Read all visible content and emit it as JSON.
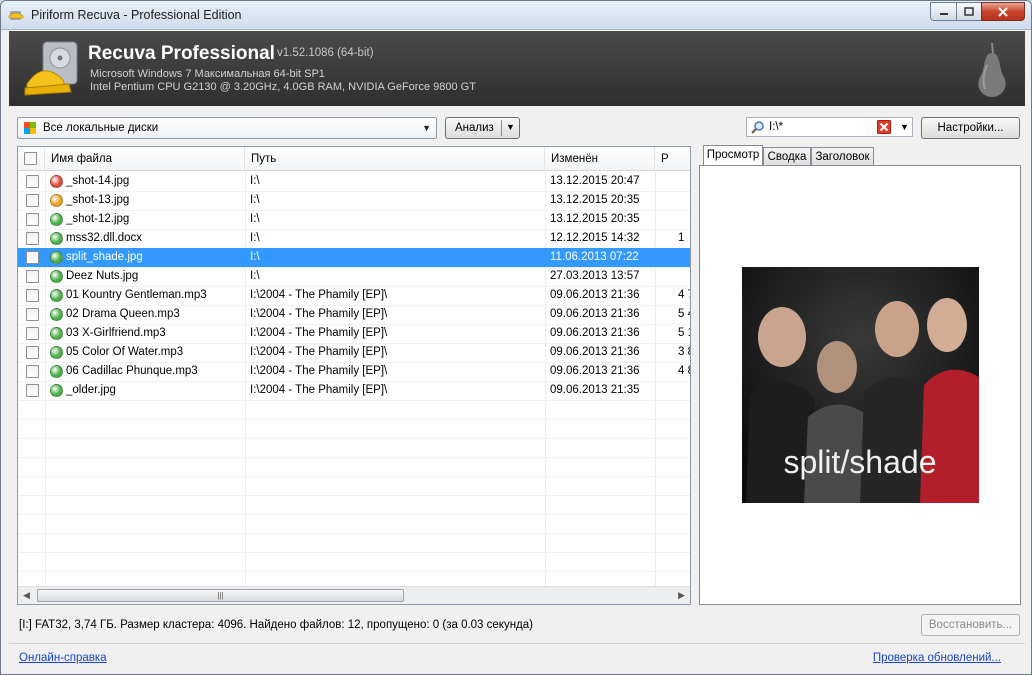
{
  "window": {
    "title": "Piriform Recuva - Professional Edition"
  },
  "header": {
    "product": "Recuva Professional",
    "version": "v1.52.1086 (64-bit)",
    "os": "Microsoft Windows 7 Максимальная 64-bit SP1",
    "cpu": "Intel Pentium CPU G2130 @ 3.20GHz, 4.0GB RAM, NVIDIA GeForce 9800 GT"
  },
  "toolbar": {
    "drive_value": "Все локальные диски",
    "scan_label": "Анализ",
    "search_value": "I:\\*",
    "options_label": "Настройки..."
  },
  "columns": {
    "name": "Имя файла",
    "path": "Путь",
    "modified": "Изменён",
    "size": "Р"
  },
  "files": [
    {
      "name": "_shot-14.jpg",
      "path": "I:\\",
      "modified": "13.12.2015 20:47",
      "size": "",
      "state": "red",
      "selected": false
    },
    {
      "name": "_shot-13.jpg",
      "path": "I:\\",
      "modified": "13.12.2015 20:35",
      "size": "",
      "state": "orange",
      "selected": false
    },
    {
      "name": "_shot-12.jpg",
      "path": "I:\\",
      "modified": "13.12.2015 20:35",
      "size": "",
      "state": "green",
      "selected": false
    },
    {
      "name": "mss32.dll.docx",
      "path": "I:\\",
      "modified": "12.12.2015 14:32",
      "size": "1",
      "state": "green",
      "selected": false
    },
    {
      "name": "split_shade.jpg",
      "path": "I:\\",
      "modified": "11.06.2013 07:22",
      "size": "",
      "state": "green",
      "selected": true
    },
    {
      "name": "Deez Nuts.jpg",
      "path": "I:\\",
      "modified": "27.03.2013 13:57",
      "size": "",
      "state": "green",
      "selected": false
    },
    {
      "name": "01 Kountry Gentleman.mp3",
      "path": "I:\\2004 - The Phamily [EP]\\",
      "modified": "09.06.2013 21:36",
      "size": "4 7",
      "state": "green",
      "selected": false
    },
    {
      "name": "02 Drama Queen.mp3",
      "path": "I:\\2004 - The Phamily [EP]\\",
      "modified": "09.06.2013 21:36",
      "size": "5 4",
      "state": "green",
      "selected": false
    },
    {
      "name": "03 X-Girlfriend.mp3",
      "path": "I:\\2004 - The Phamily [EP]\\",
      "modified": "09.06.2013 21:36",
      "size": "5 1",
      "state": "green",
      "selected": false
    },
    {
      "name": "05 Color Of Water.mp3",
      "path": "I:\\2004 - The Phamily [EP]\\",
      "modified": "09.06.2013 21:36",
      "size": "3 8",
      "state": "green",
      "selected": false
    },
    {
      "name": "06 Cadillac Phunque.mp3",
      "path": "I:\\2004 - The Phamily [EP]\\",
      "modified": "09.06.2013 21:36",
      "size": "4 8",
      "state": "green",
      "selected": false
    },
    {
      "name": "_older.jpg",
      "path": "I:\\2004 - The Phamily [EP]\\",
      "modified": "09.06.2013 21:35",
      "size": "",
      "state": "green",
      "selected": false
    }
  ],
  "tabs": [
    {
      "label": "Просмотр",
      "active": true
    },
    {
      "label": "Сводка",
      "active": false
    },
    {
      "label": "Заголовок",
      "active": false
    }
  ],
  "preview": {
    "caption": "split/shade"
  },
  "status": "[I:] FAT32, 3,74 ГБ. Размер кластера: 4096. Найдено файлов: 12, пропущено: 0 (за 0.03 секунда)",
  "recover_label": "Восстановить...",
  "links": {
    "help": "Онлайн-справка",
    "updates": "Проверка обновлений..."
  },
  "icons": {
    "window": "recuva-app-icon",
    "logo": "recuva-logo-icon",
    "brand": "pear-icon",
    "drive": "drive-icon",
    "search": "search-icon",
    "clear": "clear-icon"
  },
  "colors": {
    "selected": "#3399ff",
    "state_red": "#e04b3c",
    "state_orange": "#f0a020",
    "state_green": "#4cb04a",
    "link": "#1a45c8"
  }
}
